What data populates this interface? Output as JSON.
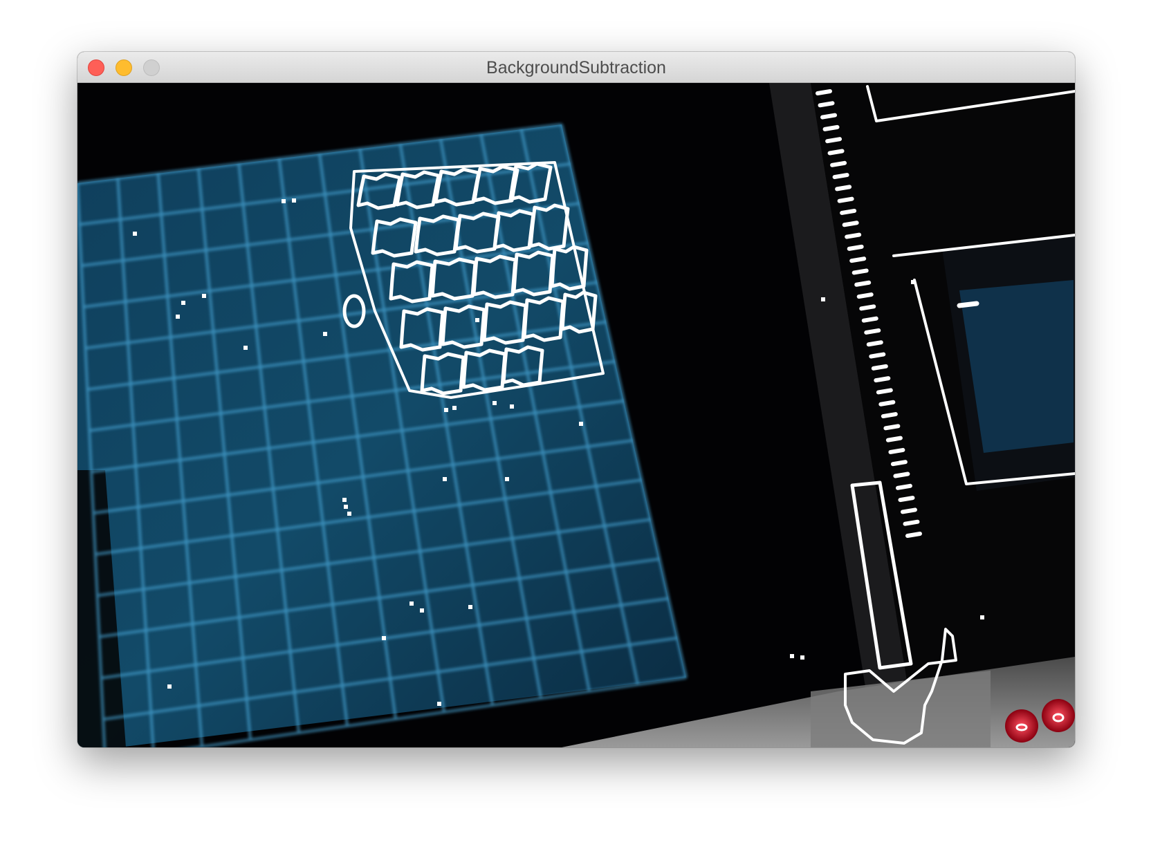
{
  "window": {
    "title": "BackgroundSubtraction",
    "controls": {
      "close": "close-icon",
      "minimize": "minimize-icon",
      "zoom": "zoom-icon"
    }
  },
  "colors": {
    "titlebar": "#e3e3e3",
    "close": "#fe5f57",
    "minimize": "#febc2e",
    "zoom_inactive": "#d0d0d0",
    "screen_glow": "#1f6a8f",
    "grid_line": "#4aa7d8",
    "foreground_mask": "#ffffff"
  }
}
